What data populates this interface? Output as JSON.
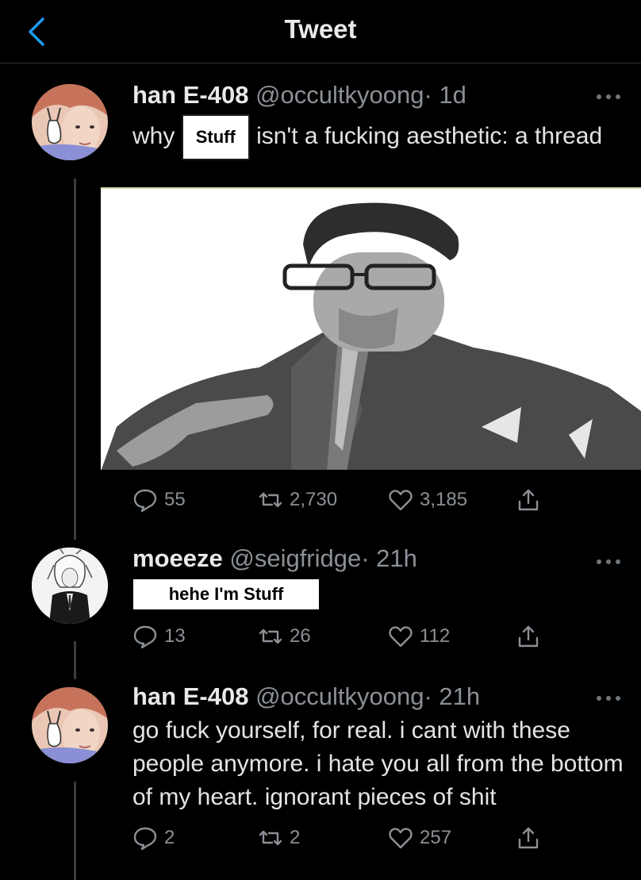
{
  "header": {
    "title": "Tweet",
    "back_icon": "chevron-left-icon",
    "accent": "#1d9bf0"
  },
  "tweets": [
    {
      "name": "han E-408",
      "handle": "@occultkyoong",
      "time": "· 1d",
      "text_before": "why",
      "censor": "Stuff",
      "text_after": "isn't a fucking aesthetic: a thread",
      "has_media": true,
      "replies": "55",
      "retweets": "2,730",
      "likes": "3,185"
    },
    {
      "name": "moeeze",
      "handle": "@seigfridge",
      "time": "· 21h",
      "censor": "hehe I'm Stuff",
      "replies": "13",
      "retweets": "26",
      "likes": "112"
    },
    {
      "name": "han E-408",
      "handle": "@occultkyoong",
      "time": "· 21h",
      "text": "go fuck yourself, for real. i cant with these people anymore. i hate you all from the bottom of my heart. ignorant pieces of shit",
      "replies": "2",
      "retweets": "2",
      "likes": "257"
    }
  ]
}
